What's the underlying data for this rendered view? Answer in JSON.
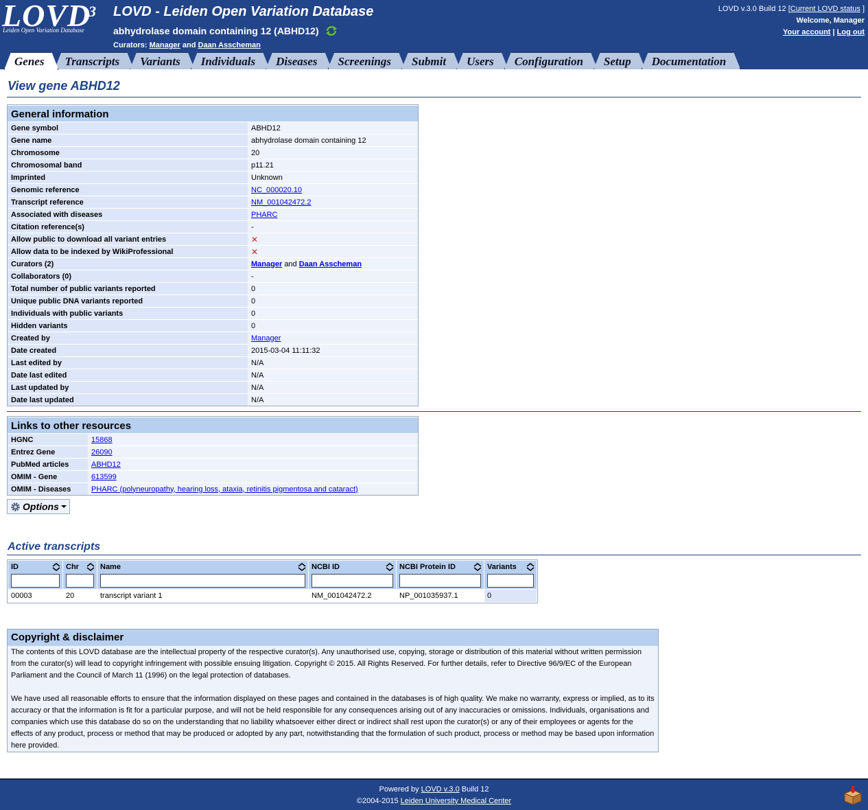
{
  "header": {
    "logo_text": "LOVD",
    "logo_sup": "3",
    "logo_tagline": "Leiden Open Variation Database",
    "site_title": "LOVD - Leiden Open Variation Database",
    "gene_title": "abhydrolase domain containing 12 (ABHD12)",
    "curators_label": "Curators:",
    "curator_1": "Manager",
    "curators_and": "and",
    "curator_2": "Daan Asscheman",
    "version_text": "LOVD v.3.0 Build 12 [",
    "status_link": "Current LOVD status",
    "status_close": "]",
    "welcome": "Welcome, Manager",
    "account_link": "Your account",
    "separator": "|",
    "logout_link": "Log out"
  },
  "tabs": [
    "Genes",
    "Transcripts",
    "Variants",
    "Individuals",
    "Diseases",
    "Screenings",
    "Submit",
    "Users",
    "Configuration",
    "Setup",
    "Documentation"
  ],
  "page_title": "View gene ABHD12",
  "general": {
    "title": "General information",
    "rows": [
      {
        "label": "Gene symbol",
        "value": "ABHD12"
      },
      {
        "label": "Gene name",
        "value": "abhydrolase domain containing 12"
      },
      {
        "label": "Chromosome",
        "value": "20"
      },
      {
        "label": "Chromosomal band",
        "value": "p11.21"
      },
      {
        "label": "Imprinted",
        "value": "Unknown"
      },
      {
        "label": "Genomic reference",
        "value": "NC_000020.10"
      },
      {
        "label": "Transcript reference",
        "value": "NM_001042472.2"
      },
      {
        "label": "Associated with diseases",
        "value": "PHARC"
      },
      {
        "label": "Citation reference(s)",
        "value": "-"
      },
      {
        "label": "Allow public to download all variant entries",
        "value": "✕"
      },
      {
        "label": "Allow data to be indexed by WikiProfessional",
        "value": "✕"
      },
      {
        "label": "Curators (2)",
        "value": "Manager",
        "value_and": "and",
        "value_2": "Daan Asscheman"
      },
      {
        "label": "Collaborators (0)",
        "value": "-"
      },
      {
        "label": "Total number of public variants reported",
        "value": "0"
      },
      {
        "label": "Unique public DNA variants reported",
        "value": "0"
      },
      {
        "label": "Individuals with public variants",
        "value": "0"
      },
      {
        "label": "Hidden variants",
        "value": "0"
      },
      {
        "label": "Created by",
        "value": "Manager"
      },
      {
        "label": "Date created",
        "value": "2015-03-04 11:11:32"
      },
      {
        "label": "Last edited by",
        "value": "N/A"
      },
      {
        "label": "Date last edited",
        "value": "N/A"
      },
      {
        "label": "Last updated by",
        "value": "N/A"
      },
      {
        "label": "Date last updated",
        "value": "N/A"
      }
    ]
  },
  "links": {
    "title": "Links to other resources",
    "rows": [
      {
        "label": "HGNC",
        "value": "15868"
      },
      {
        "label": "Entrez Gene",
        "value": "26090"
      },
      {
        "label": "PubMed articles",
        "value": "ABHD12"
      },
      {
        "label": "OMIM - Gene",
        "value": "613599"
      },
      {
        "label": "OMIM - Diseases",
        "value": "PHARC (polyneuropathy, hearing loss, ataxia, retinitis pigmentosa and cataract)"
      }
    ]
  },
  "options_label": "Options",
  "transcripts": {
    "title": "Active transcripts",
    "columns": [
      "ID",
      "Chr",
      "Name",
      "NCBI ID",
      "NCBI Protein ID",
      "Variants"
    ],
    "rows": [
      [
        "00003",
        "20",
        "transcript variant 1",
        "NM_001042472.2",
        "NP_001035937.1",
        "0"
      ]
    ]
  },
  "copyright": {
    "title": "Copyright & disclaimer",
    "p1": "The contents of this LOVD database are the intellectual property of the respective curator(s). Any unauthorised use, copying, storage or distribution of this material without written permission from the curator(s) will lead to copyright infringement with possible ensuing litigation. Copyright © 2015. All Rights Reserved. For further details, refer to Directive 96/9/EC of the European Parliament and the Council of March 11 (1996) on the legal protection of databases.",
    "p2": "We have used all reasonable efforts to ensure that the information displayed on these pages and contained in the databases is of high quality. We make no warranty, express or implied, as to its accuracy or that the information is fit for a particular purpose, and will not be held responsible for any consequences arising out of any inaccuracies or omissions. Individuals, organisations and companies which use this database do so on the understanding that no liability whatsoever either direct or indirect shall rest upon the curator(s) or any of their employees or agents for the effects of any product, process or method that may be produced or adopted by any part, notwithstanding that the formulation of such product, process or method may be based upon information here provided."
  },
  "footer": {
    "powered_by": "Powered by",
    "lovd_link": "LOVD v.3.0",
    "build": "Build 12",
    "copyright_prefix": "©2004-2015",
    "lumc_link": "Leiden University Medical Center"
  },
  "icons": {
    "refresh": "refresh-icon",
    "options": "gear-icon",
    "sort": "sort-icon",
    "remove": "red-x-icon",
    "footer": "package-icon"
  }
}
